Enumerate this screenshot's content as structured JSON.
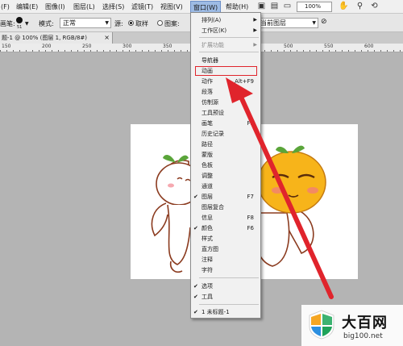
{
  "menubar": {
    "items": [
      "(F)",
      "编辑(E)",
      "图像(I)",
      "图层(L)",
      "选择(S)",
      "滤镜(T)",
      "视图(V)",
      "窗口(W)",
      "帮助(H)"
    ],
    "zoom": "100%",
    "icons": [
      "mini-bridge-icon",
      "arrange-icon",
      "screen-mode-icon",
      "hand-tool-icon",
      "zoom-tool-icon",
      "rotate-view-icon"
    ]
  },
  "options": {
    "brush_label": "画笔:",
    "brush_size": "51",
    "mode_label": "模式:",
    "mode_value": "正常",
    "source_label": "源:",
    "sampled": "取样",
    "pattern": "图案:",
    "layer_select": "当前图层"
  },
  "doc_tab": {
    "title": "题-1 @ 100% (图层 1, RGB/8#)",
    "close": "×"
  },
  "ruler": [
    "150",
    "200",
    "250",
    "300",
    "350",
    "400",
    "450",
    "500",
    "550",
    "600",
    "650"
  ],
  "window_menu": {
    "items": [
      {
        "label": "排列(A)",
        "submenu": true
      },
      {
        "label": "工作区(K)",
        "submenu": true
      },
      {
        "label": "扩展功能",
        "submenu": true,
        "disabled": true
      },
      {
        "label": "导航器"
      },
      {
        "label": "动画",
        "highlighted": true
      },
      {
        "label": "动作",
        "shortcut": "Alt+F9"
      },
      {
        "label": "段落"
      },
      {
        "label": "仿制源"
      },
      {
        "label": "工具预设"
      },
      {
        "label": "画笔",
        "shortcut": "F5"
      },
      {
        "label": "历史记录"
      },
      {
        "label": "路径"
      },
      {
        "label": "蒙版"
      },
      {
        "label": "色板"
      },
      {
        "label": "调整"
      },
      {
        "label": "通道"
      },
      {
        "label": "图层",
        "shortcut": "F7",
        "checked": true
      },
      {
        "label": "图层复合"
      },
      {
        "label": "信息",
        "shortcut": "F8"
      },
      {
        "label": "颜色",
        "shortcut": "F6",
        "checked": true
      },
      {
        "label": "样式"
      },
      {
        "label": "直方图"
      },
      {
        "label": "注释"
      },
      {
        "label": "字符"
      },
      {
        "label": "选项",
        "checked": true
      },
      {
        "label": "工具",
        "checked": true
      },
      {
        "label": "1 未标题-1",
        "checked": true
      }
    ]
  },
  "watermark": {
    "title": "大百网",
    "url": "big100.net"
  },
  "colors": {
    "highlight": "#e0242c",
    "arrow": "#e0242c",
    "active_menu": "#9dbbe4"
  }
}
